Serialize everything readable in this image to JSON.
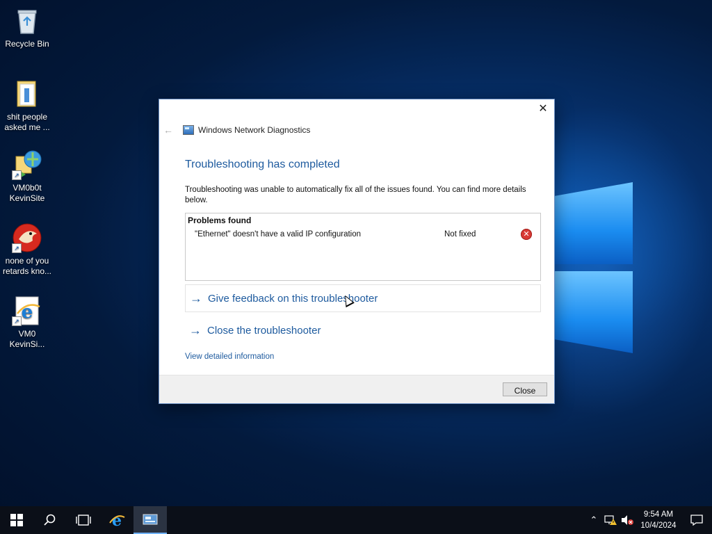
{
  "desktop": {
    "icons": [
      {
        "label": "Recycle Bin",
        "icon": "recycle-bin-icon"
      },
      {
        "label": "shit people asked me ...",
        "icon": "text-file-icon"
      },
      {
        "label": "VM0b0t KevinSite",
        "icon": "network-shortcut-icon"
      },
      {
        "label": "none of you retards kno...",
        "icon": "bird-app-icon"
      },
      {
        "label": "VM0 KevinSi...",
        "icon": "internet-explorer-icon"
      }
    ]
  },
  "dialog": {
    "app_title": "Windows Network Diagnostics",
    "close_glyph": "✕",
    "back_glyph": "←",
    "heading": "Troubleshooting has completed",
    "description": "Troubleshooting was unable to automatically fix all of the issues found. You can find more details below.",
    "problems_header": "Problems found",
    "problems": [
      {
        "name": "\"Ethernet\" doesn't have a valid IP configuration",
        "status": "Not fixed",
        "status_icon": "error-icon"
      }
    ],
    "links": {
      "feedback": "Give feedback on this troubleshooter",
      "close_troubleshooter": "Close the troubleshooter",
      "detailed_info": "View detailed information"
    },
    "close_button": "Close"
  },
  "taskbar": {
    "pinned": [
      "start-icon",
      "search-icon",
      "task-view-icon",
      "internet-explorer-icon",
      "network-diagnostics-icon"
    ],
    "time": "9:54 AM",
    "date": "10/4/2024"
  },
  "colors": {
    "accent": "#1d5a9e",
    "error": "#d93a35",
    "taskbar": "#0b0f18"
  }
}
